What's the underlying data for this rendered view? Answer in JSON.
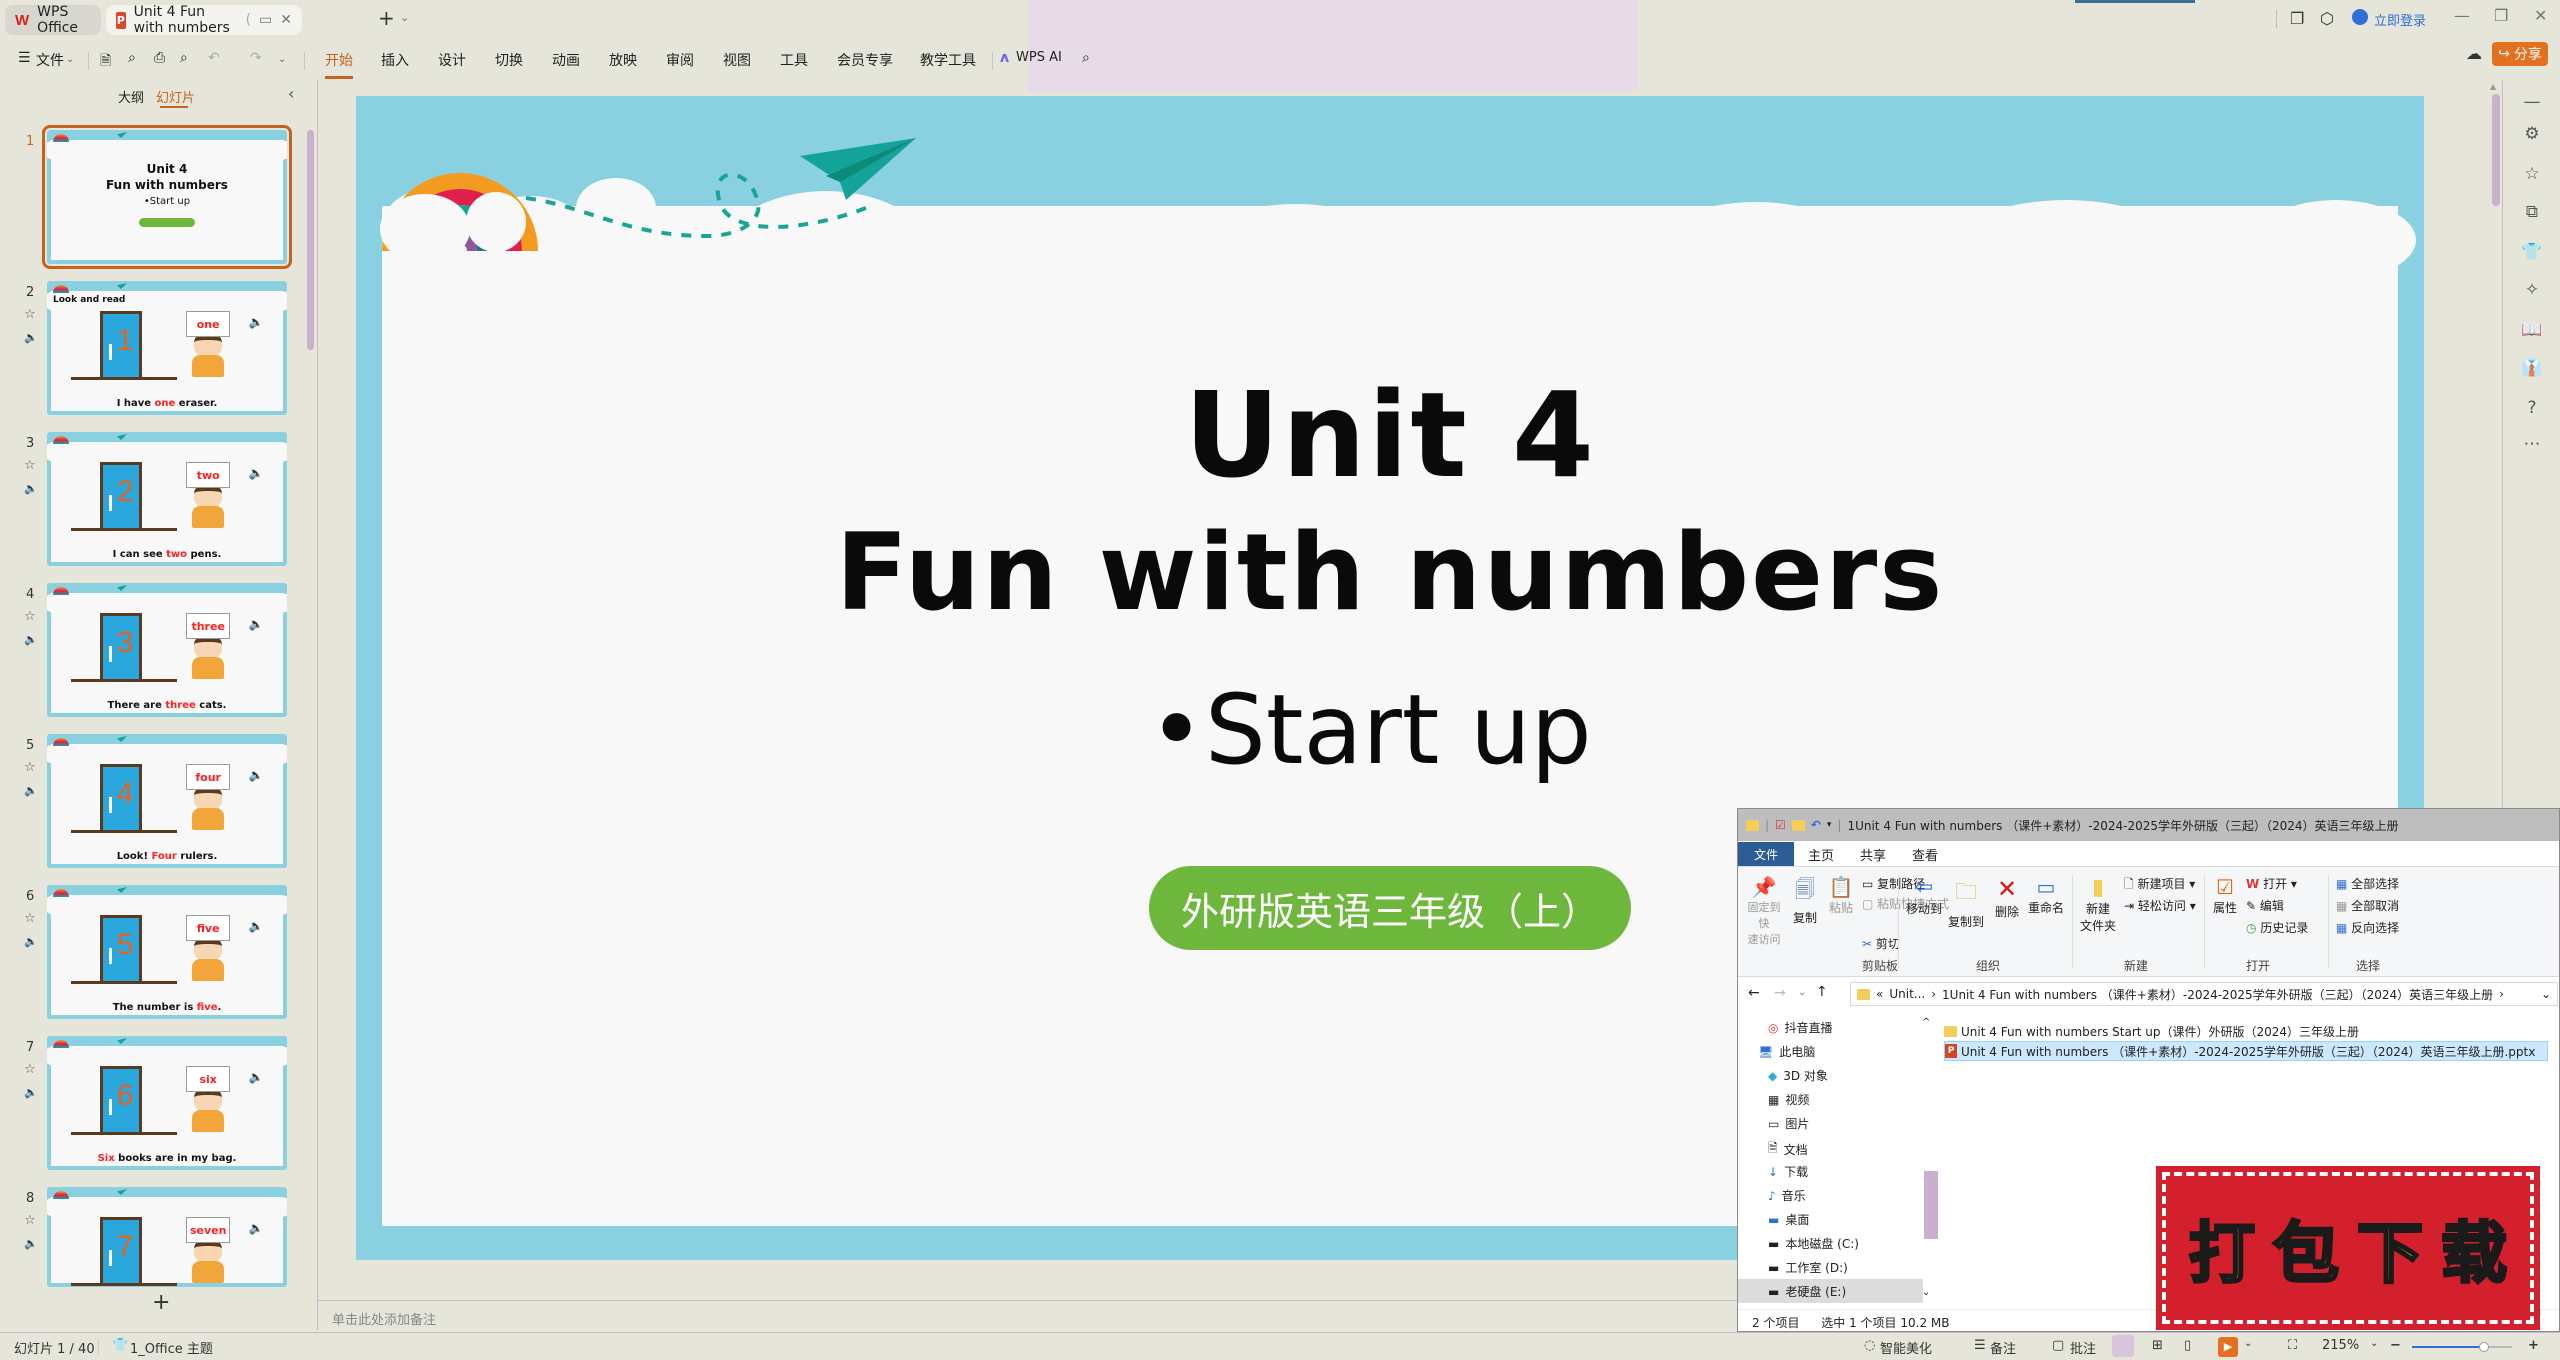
{
  "titlebar": {
    "home_tab": "WPS Office",
    "doc_tab": "Unit 4 Fun with numbers",
    "doc_tab_extra": "(",
    "login": "立即登录"
  },
  "menubar": {
    "file": "文件",
    "items": [
      "开始",
      "插入",
      "设计",
      "切换",
      "动画",
      "放映",
      "审阅",
      "视图",
      "工具",
      "会员专享",
      "教学工具"
    ],
    "active_index": 0,
    "wps_ai": "WPS AI",
    "share": "分享"
  },
  "leftpanel": {
    "tab_outline": "大纲",
    "tab_slides": "幻灯片",
    "add_slide": "+",
    "slides": [
      {
        "n": "1",
        "type": "title",
        "l1": "Unit 4",
        "l2": "Fun with numbers",
        "l3": "•Start up"
      },
      {
        "n": "2",
        "heading": "Look and read",
        "digit": "1",
        "word": "one",
        "pre": "I have ",
        "hl": "one",
        "post": " eraser."
      },
      {
        "n": "3",
        "digit": "2",
        "word": "two",
        "pre": "I can see ",
        "hl": "two",
        "post": " pens."
      },
      {
        "n": "4",
        "digit": "3",
        "word": "three",
        "pre": "There are ",
        "hl": "three",
        "post": " cats."
      },
      {
        "n": "5",
        "digit": "4",
        "word": "four",
        "pre": "Look! ",
        "hl": "Four",
        "post": " rulers."
      },
      {
        "n": "6",
        "digit": "5",
        "word": "five",
        "pre": "The number is ",
        "hl": "five",
        "post": "."
      },
      {
        "n": "7",
        "digit": "6",
        "word": "six",
        "pre": "",
        "hl": "Six",
        "post": " books are in my bag."
      },
      {
        "n": "8",
        "digit": "7",
        "word": "seven",
        "pre": "",
        "hl": "",
        "post": ""
      }
    ]
  },
  "slide": {
    "title": "Unit 4",
    "subtitle": "Fun with numbers",
    "bullet": "•Start up",
    "badge": "外研版英语三年级（上）",
    "badge_color": "#6db83c",
    "frame_color": "#89d0e0"
  },
  "notes": {
    "placeholder": "单击此处添加备注"
  },
  "statusbar": {
    "slide_count": "幻灯片 1 / 40",
    "theme": "1_Office 主题",
    "beautify": "智能美化",
    "notes": "备注",
    "comment": "批注",
    "zoom": "215%",
    "zoom_fraction": 0.72
  },
  "explorer": {
    "title": "1Unit 4 Fun with numbers （课件+素材）-2024-2025学年外研版（三起）（2024）英语三年级上册",
    "tabs": [
      "文件",
      "主页",
      "共享",
      "查看"
    ],
    "ribbon": {
      "pin": "固定到快\n速访问",
      "copy": "复制",
      "paste": "粘贴",
      "copy_path": "复制路径",
      "paste_shortcut": "粘贴快捷方式",
      "cut": "剪切",
      "move_to": "移动到",
      "copy_to": "复制到",
      "delete": "删除",
      "rename": "重命名",
      "new_folder": "新建\n文件夹",
      "new_item": "新建项目",
      "easy_access": "轻松访问",
      "properties": "属性",
      "open": "打开",
      "edit": "编辑",
      "history": "历史记录",
      "select_all": "全部选择",
      "select_none": "全部取消",
      "invert": "反向选择",
      "groups": [
        "剪贴板",
        "组织",
        "新建",
        "打开",
        "选择"
      ]
    },
    "address": [
      "«",
      "Unit...",
      "›",
      "1Unit 4 Fun with numbers （课件+素材）-2024-2025学年外研版（三起）（2024）英语三年级上册",
      "›"
    ],
    "nav": [
      "抖音直播",
      "此电脑",
      "3D 对象",
      "视频",
      "图片",
      "文档",
      "下载",
      "音乐",
      "桌面",
      "本地磁盘 (C:)",
      "工作室 (D:)",
      "老硬盘 (E:)"
    ],
    "files": [
      {
        "name": "Unit 4 Fun with numbers Start up（课件）外研版（2024）三年级上册",
        "type": "folder"
      },
      {
        "name": "Unit 4 Fun with numbers （课件+素材）-2024-2025学年外研版（三起）（2024）英语三年级上册.pptx",
        "type": "pptx",
        "selected": true
      }
    ],
    "status_items": "2 个项目",
    "status_selected": "选中 1 个项目  10.2 MB"
  },
  "stamp": {
    "text": [
      "打",
      "包",
      "下",
      "载"
    ]
  }
}
